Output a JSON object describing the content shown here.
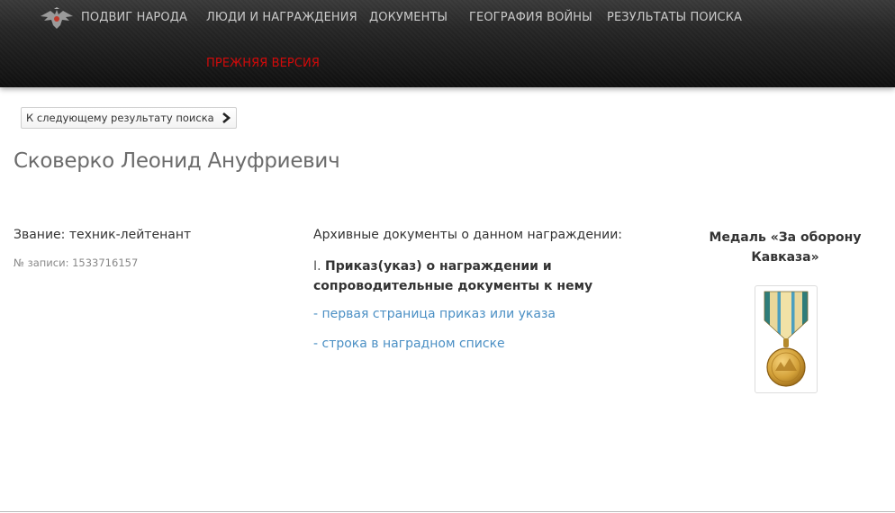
{
  "nav": {
    "items": [
      {
        "label": "ПОДВИГ НАРОДА",
        "left": 0
      },
      {
        "label": "ЛЮДИ И НАГРАЖДЕНИЯ"
      },
      {
        "label": "ДОКУМЕНТЫ"
      },
      {
        "label": "ГЕОГРАФИЯ ВОЙНЫ"
      },
      {
        "label": "РЕЗУЛЬТАТЫ ПОИСКА"
      }
    ],
    "old_version_label": "ПРЕЖНЯЯ ВЕРСИЯ",
    "logo_icon": "double-headed-eagle-icon"
  },
  "next_result": {
    "label": "К следующему результату поиска",
    "icon": "chevron-right-icon"
  },
  "person": {
    "name": "Сковерко Леонид Ануфриевич",
    "rank": "Звание: техник-лейтенант",
    "record_no": "№ записи: 1533716157"
  },
  "documents": {
    "heading": "Архивные документы о данном награждении:",
    "item_number": "I.",
    "item_title": "Приказ(указ) о награждении и сопроводительные документы к нему",
    "links": [
      "- первая страница приказ или указа",
      "- строка в наградном списке"
    ]
  },
  "award": {
    "name": "Медаль «За оборону Кавказа»",
    "icon": "medal-icon"
  },
  "colors": {
    "nav_text": "#c9c9c9",
    "old_version": "#d20a0a",
    "link": "#4a8fc4",
    "title": "#6b6b6b"
  }
}
